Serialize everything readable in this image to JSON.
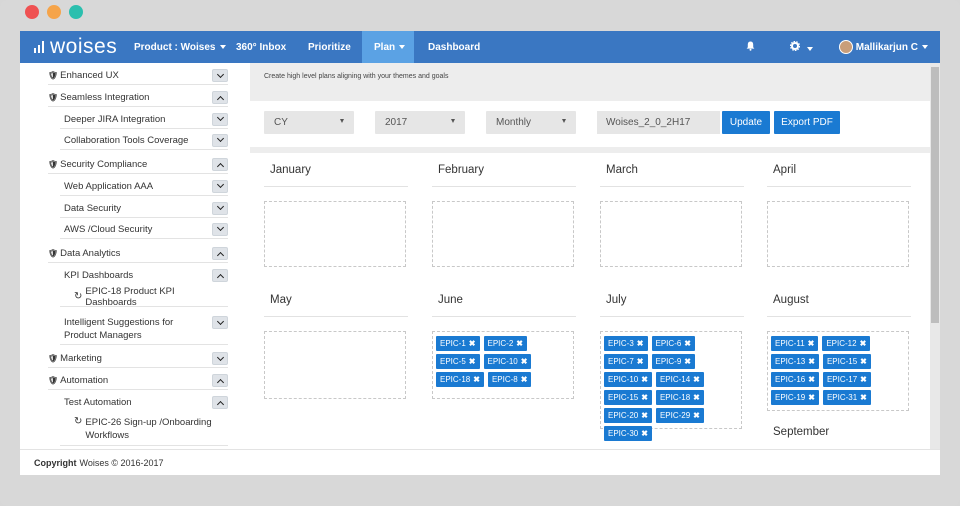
{
  "window": {
    "traffic_lights": [
      "#ef5152",
      "#f5a44a",
      "#2bbfae"
    ]
  },
  "navbar": {
    "logo": "woises",
    "items": [
      {
        "label": "Product : Woises",
        "has_caret": true,
        "active": false
      },
      {
        "label": "360° Inbox",
        "has_caret": false,
        "active": false
      },
      {
        "label": "Prioritize",
        "has_caret": false,
        "active": false
      },
      {
        "label": "Plan",
        "has_caret": true,
        "active": true
      },
      {
        "label": "Dashboard",
        "has_caret": false,
        "active": false
      }
    ],
    "user_name": "Mallikarjun C",
    "colors": {
      "bar": "#3a77c2",
      "active": "#5ba2e4"
    }
  },
  "sidebar": {
    "items": [
      {
        "label": "Enhanced UX",
        "level": 0,
        "expanded": false
      },
      {
        "label": "Seamless Integration",
        "level": 0,
        "expanded": true
      },
      {
        "label": "Deeper JIRA Integration",
        "level": 1,
        "expanded": false
      },
      {
        "label": "Collaboration Tools Coverage",
        "level": 1,
        "expanded": false
      },
      {
        "label": "Security Compliance",
        "level": 0,
        "expanded": true
      },
      {
        "label": "Web Application AAA",
        "level": 1,
        "expanded": false
      },
      {
        "label": "Data Security",
        "level": 1,
        "expanded": false
      },
      {
        "label": "AWS /Cloud Security",
        "level": 1,
        "expanded": false
      },
      {
        "label": "Data Analytics",
        "level": 0,
        "expanded": true
      },
      {
        "label": "KPI Dashboards",
        "level": 1,
        "expanded": true
      },
      {
        "label": "EPIC-18 Product KPI Dashboards",
        "level": 2
      },
      {
        "label": "Intelligent Suggestions for Product Managers",
        "level": 1,
        "expanded": false
      },
      {
        "label": "Marketing",
        "level": 0,
        "expanded": false
      },
      {
        "label": "Automation",
        "level": 0,
        "expanded": true
      },
      {
        "label": "Test Automation",
        "level": 1,
        "expanded": true
      },
      {
        "label": "EPIC-26 Sign-up /Onboarding Workflows",
        "level": 2
      }
    ]
  },
  "main": {
    "subtitle": "Create high level plans aligning with your themes and goals",
    "filters": {
      "calendar_type": "CY",
      "year": "2017",
      "period": "Monthly",
      "plan_name": "Woises_2_0_2H17",
      "update_label": "Update",
      "export_label": "Export PDF"
    },
    "months": [
      {
        "name": "January",
        "epics": []
      },
      {
        "name": "February",
        "epics": []
      },
      {
        "name": "March",
        "epics": []
      },
      {
        "name": "April",
        "epics": []
      },
      {
        "name": "May",
        "epics": []
      },
      {
        "name": "June",
        "epics": [
          "EPIC-1",
          "EPIC-2",
          "EPIC-5",
          "EPIC-10",
          "EPIC-18",
          "EPIC-8"
        ]
      },
      {
        "name": "July",
        "epics": [
          "EPIC-3",
          "EPIC-6",
          "EPIC-7",
          "EPIC-9",
          "EPIC-10",
          "EPIC-14",
          "EPIC-15",
          "EPIC-18",
          "EPIC-20",
          "EPIC-29",
          "EPIC-30"
        ]
      },
      {
        "name": "August",
        "epics": [
          "EPIC-11",
          "EPIC-12",
          "EPIC-13",
          "EPIC-15",
          "EPIC-16",
          "EPIC-17",
          "EPIC-19",
          "EPIC-31"
        ]
      },
      {
        "name": "September",
        "epics": []
      }
    ],
    "chip_color": "#1a7ad2"
  },
  "footer": {
    "copyright_label": "Copyright",
    "copyright_text": "Woises © 2016-2017"
  }
}
